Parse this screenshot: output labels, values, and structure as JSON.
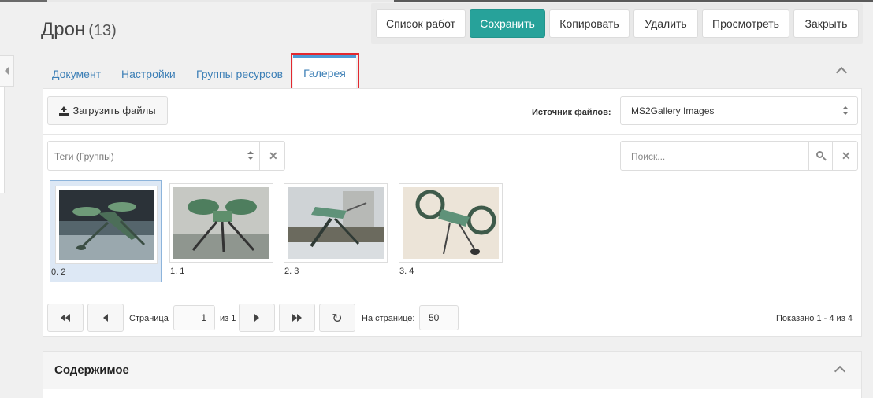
{
  "header": {
    "title": "Дрон",
    "count": "(13)"
  },
  "actions": {
    "list_label": "Список работ",
    "save_label": "Сохранить",
    "copy_label": "Копировать",
    "delete_label": "Удалить",
    "view_label": "Просмотреть",
    "close_label": "Закрыть"
  },
  "tabs": [
    {
      "label": "Документ"
    },
    {
      "label": "Настройки"
    },
    {
      "label": "Группы ресурсов"
    },
    {
      "label": "Галерея"
    }
  ],
  "gallery": {
    "upload_label": "Загрузить файлы",
    "source_label": "Источник файлов:",
    "source_value": "MS2Gallery Images",
    "tags_placeholder": "Теги (Группы)",
    "search_placeholder": "Поиск...",
    "images": [
      {
        "caption": "0. 2",
        "selected": true
      },
      {
        "caption": "1. 1",
        "selected": false
      },
      {
        "caption": "2. 3",
        "selected": false
      },
      {
        "caption": "3. 4",
        "selected": false
      }
    ]
  },
  "pagination": {
    "page_label": "Страница",
    "page_value": "1",
    "of_label": "из 1",
    "per_page_label": "На странице:",
    "per_page_value": "50",
    "shown_label": "Показано 1 - 4 из 4"
  },
  "content_section": {
    "title": "Содержимое"
  },
  "colors": {
    "primary": "#27a29a",
    "link": "#3c7fb6",
    "active_tab_border": "#4d9ad6",
    "highlight": "#e3292f"
  }
}
